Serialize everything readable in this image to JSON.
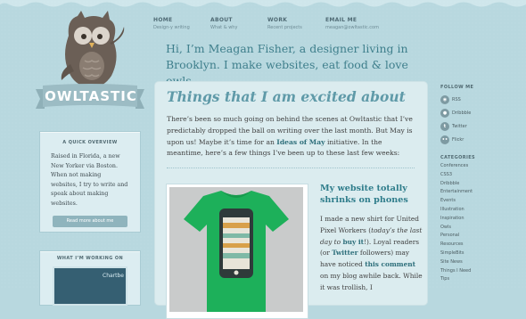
{
  "site": {
    "logo_text": "OWLTASTIC"
  },
  "nav": [
    {
      "label": "HOME",
      "sub": "Design-y writing"
    },
    {
      "label": "ABOUT",
      "sub": "What & why"
    },
    {
      "label": "WORK",
      "sub": "Recent projects"
    },
    {
      "label": "EMAIL ME",
      "sub": "meagan@owltastic.com"
    }
  ],
  "intro": {
    "line1": "Hi, I’m Meagan Fisher, a designer living in",
    "line2": "Brooklyn. I make websites, eat food & love owls."
  },
  "left": {
    "overview_title": "A QUICK OVERVIEW",
    "overview_text": "Raised in Florida, a new New Yorker via Boston. When not making websites, I try to write and speak about making websites.",
    "overview_button": "Read more about me",
    "working_title": "WHAT I’M WORKING ON",
    "working_image_label": "Chartbe"
  },
  "post": {
    "heading": "Things that I am excited about",
    "para_a": "There’s been so much going on behind the scenes at Owltastic that I’ve predictably dropped the ball on writing over the last month. But May is upon us! Maybe it’s time for an ",
    "para_link": "Ideas of May",
    "para_b": " initiative. In the meantime, here’s a few things I’ve been up to these last few weeks:",
    "shirt_caption": "",
    "sub_title": "My website totally shrinks on phones",
    "body_a": "I made a new shirt for United Pixel Workers (",
    "body_italic": "today’s the last day to ",
    "body_buy": "buy it",
    "body_b": "!). Loyal readers (or ",
    "body_twitter": "Twitter",
    "body_c": " followers) may have noticed ",
    "body_comment": "this comment",
    "body_d": " on my blog awhile back. While it was trollish, I"
  },
  "follow": {
    "title": "FOLLOW ME",
    "items": [
      {
        "icon": "rss-icon",
        "label": "RSS"
      },
      {
        "icon": "dribbble-icon",
        "label": "Dribbble"
      },
      {
        "icon": "twitter-icon",
        "label": "Twitter"
      },
      {
        "icon": "flickr-icon",
        "label": "Flickr"
      }
    ]
  },
  "categories": {
    "title": "CATEGORIES",
    "items": [
      "Conferences",
      "CSS3",
      "Dribbble",
      "Entertainment",
      "Events",
      "Illustration",
      "Inspiration",
      "Owls",
      "Personal",
      "Resources",
      "SimpleBits",
      "Site News",
      "Things I Need",
      "Tips"
    ]
  },
  "colors": {
    "background": "#b8d8df",
    "accent": "#5f9aa8",
    "link": "#2e6f7b",
    "shirt": "#1db05a"
  }
}
